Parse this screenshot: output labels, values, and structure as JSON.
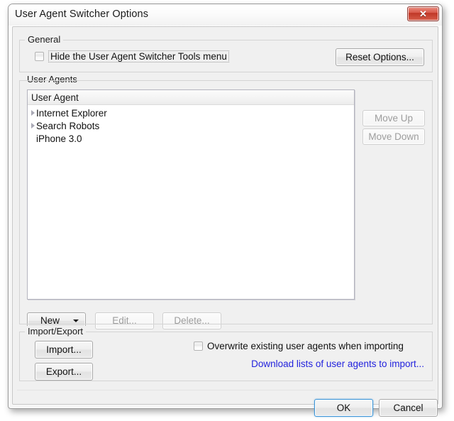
{
  "window": {
    "title": "User Agent Switcher Options",
    "close_icon": "close-icon",
    "close_glyph": "✕"
  },
  "general": {
    "legend": "General",
    "hide_menu_checkbox": {
      "label": "Hide the User Agent Switcher Tools menu",
      "checked": false
    },
    "reset_options_button": "Reset Options..."
  },
  "user_agents": {
    "legend": "User Agents",
    "list": {
      "column_header": "User Agent",
      "rows": [
        {
          "label": "Internet Explorer",
          "expandable": true,
          "expanded": false
        },
        {
          "label": "Search Robots",
          "expandable": true,
          "expanded": false
        },
        {
          "label": "iPhone 3.0",
          "expandable": false,
          "expanded": false
        }
      ]
    },
    "move_up_button": "Move Up",
    "move_down_button": "Move Down",
    "new_button": "New",
    "new_button_caret_icon": "chevron-down-icon",
    "edit_button": "Edit...",
    "delete_button": "Delete..."
  },
  "import_export": {
    "legend": "Import/Export",
    "import_button": "Import...",
    "export_button": "Export...",
    "overwrite_checkbox": {
      "label": "Overwrite existing user agents when importing",
      "checked": false
    },
    "download_link": "Download lists of user agents to import..."
  },
  "footer": {
    "ok_button": "OK",
    "cancel_button": "Cancel"
  },
  "colors": {
    "link": "#2222dd",
    "default_button_border": "#3c94d6",
    "close_button": "#bf3726",
    "dialog_background": "#f0f0f0",
    "disabled_text": "#9d9d9d"
  }
}
